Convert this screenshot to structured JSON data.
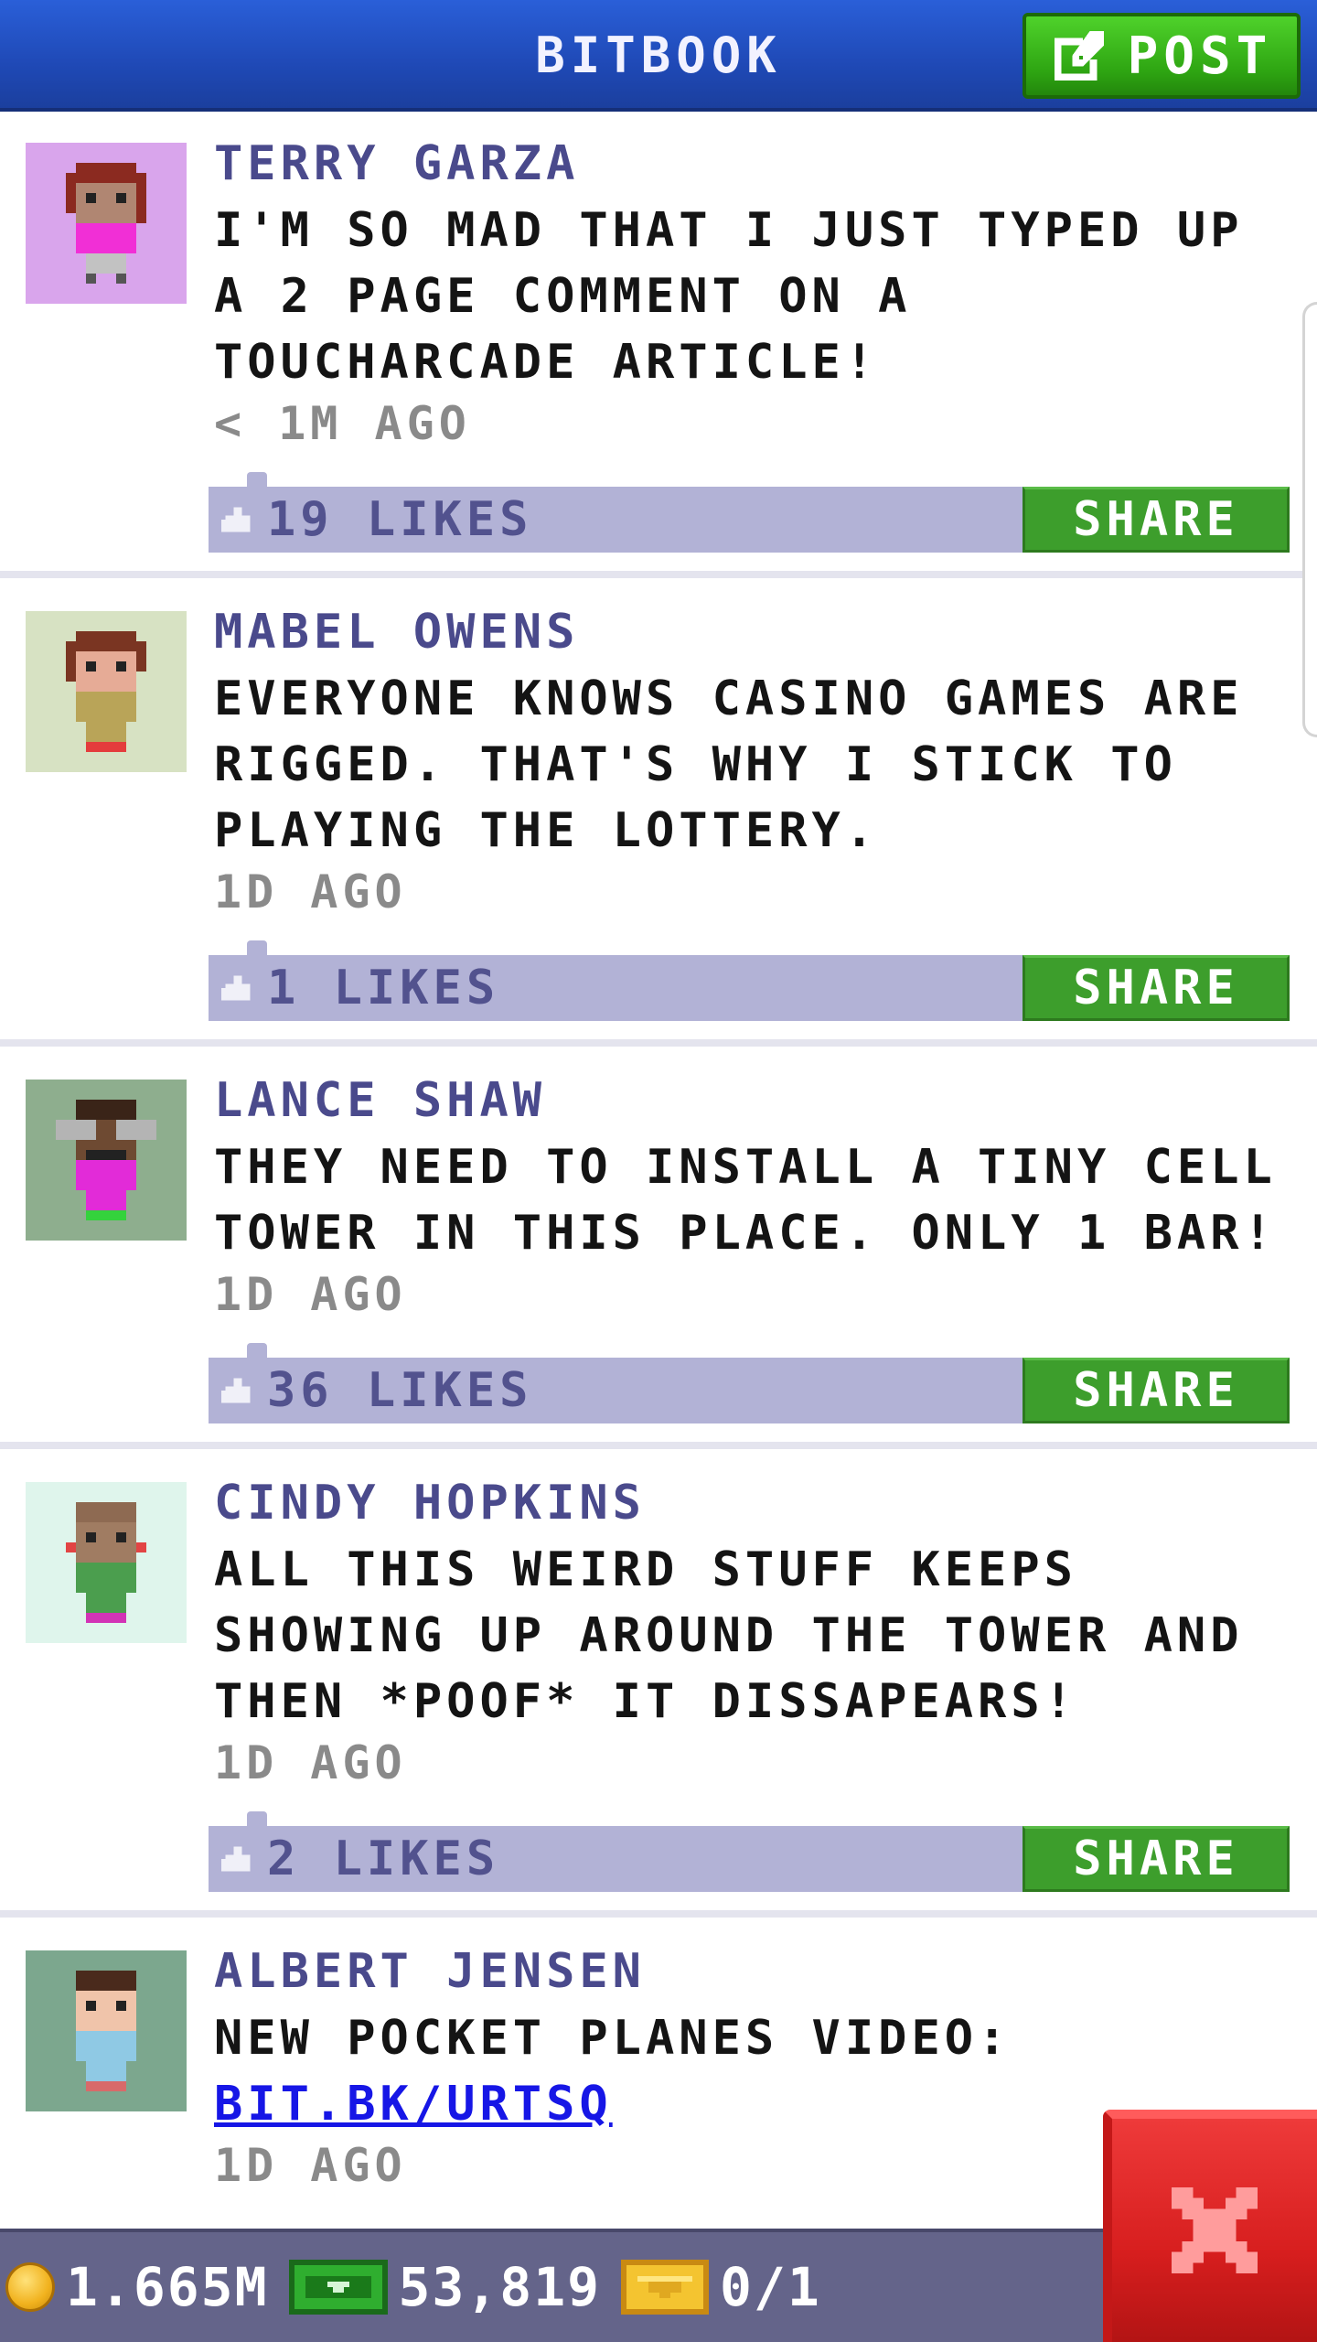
{
  "header": {
    "title": "BITBOOK",
    "post_label": "POST"
  },
  "posts": [
    {
      "author": "TERRY GARZA",
      "text": "I'M SO MAD THAT I JUST TYPED UP A 2 PAGE COMMENT ON A TOUCHARCADE ARTICLE!",
      "time": "< 1M AGO",
      "likes": "19 LIKES",
      "share": "SHARE",
      "avatar": {
        "bg": "#d9a5ec",
        "skin": "#b08672",
        "hair": "#8b2a20",
        "shirt": "#f12fd6",
        "pants": "#c2c2c2"
      }
    },
    {
      "author": "MABEL OWENS",
      "text": "EVERYONE KNOWS CASINO GAMES ARE RIGGED. THAT'S WHY I STICK TO PLAYING THE LOTTERY.",
      "time": "1D AGO",
      "likes": "1 LIKES",
      "share": "SHARE",
      "avatar": {
        "bg": "#d7e2c3",
        "skin": "#e6ab96",
        "hair": "#7a3522",
        "shirt": "#b9a458",
        "pants": "#e43c3c"
      }
    },
    {
      "author": "LANCE SHAW",
      "text": "THEY NEED TO INSTALL A TINY CELL TOWER IN THIS PLACE. ONLY 1 BAR!",
      "time": "1D AGO",
      "likes": "36 LIKES",
      "share": "SHARE",
      "avatar": {
        "bg": "#8eae8e",
        "skin": "#6e4a32",
        "hair": "#b4b4b4",
        "shirt": "#e22bd8",
        "pants": "#34d23c"
      }
    },
    {
      "author": "CINDY HOPKINS",
      "text": "ALL THIS WEIRD STUFF KEEPS SHOWING UP AROUND THE TOWER AND THEN *POOF* IT DISSAPEARS!",
      "time": "1D AGO",
      "likes": "2 LIKES",
      "share": "SHARE",
      "avatar": {
        "bg": "#dff5ec",
        "skin": "#a07c62",
        "hair": "#a07c62",
        "shirt": "#4b9e4e",
        "pants": "#d233b6"
      }
    },
    {
      "author": "ALBERT JENSEN",
      "text": "NEW POCKET PLANES VIDEO:",
      "link": "BIT.BK/URTSQ",
      "time": "1D AGO",
      "avatar": {
        "bg": "#7ca78e",
        "skin": "#f0c4aa",
        "hair": "#4a2a1c",
        "shirt": "#8fc9e4",
        "pants": "#d86a6a"
      }
    }
  ],
  "status": {
    "coins": "1.665M",
    "bux": "53,819",
    "tickets": "0/1"
  },
  "icons": {
    "post": "edit-icon",
    "like": "thumbs-up-icon",
    "coin": "coin-icon",
    "bux": "bux-icon",
    "ticket": "vip-ticket-icon",
    "close": "close-icon"
  }
}
